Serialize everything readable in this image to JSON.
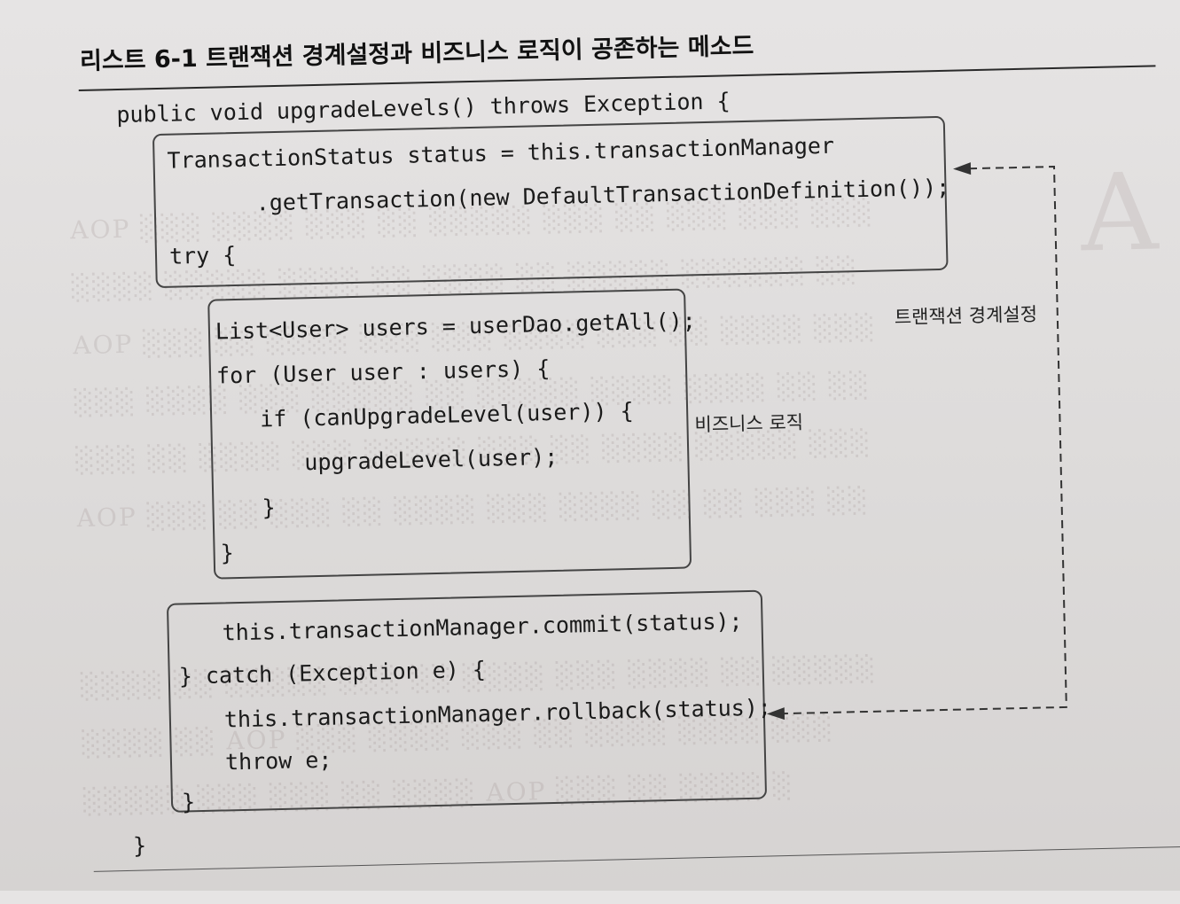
{
  "caption": "리스트 6-1 트랜잭션 경계설정과 비즈니스 로직이 공존하는 메소드",
  "code": {
    "signature": "public void upgradeLevels() throws Exception {",
    "tx_line1": "TransactionStatus status = this.transactionManager",
    "tx_line2": ".getTransaction(new DefaultTransactionDefinition());",
    "tx_try": "try {",
    "biz_line1": "List<User> users = userDao.getAll();",
    "biz_line2": "for (User user : users) {",
    "biz_line3": "if (canUpgradeLevel(user)) {",
    "biz_line4": "upgradeLevel(user);",
    "biz_line5": "}",
    "biz_line6": "}",
    "end_line1": "this.transactionManager.commit(status);",
    "end_line2": "} catch (Exception e) {",
    "end_line3": "this.transactionManager.rollback(status);",
    "end_line4": "throw e;",
    "end_line5": "}",
    "closing": "}"
  },
  "annotations": {
    "transaction_label": "트랜잭션 경계설정",
    "business_label": "비즈니스 로직"
  }
}
